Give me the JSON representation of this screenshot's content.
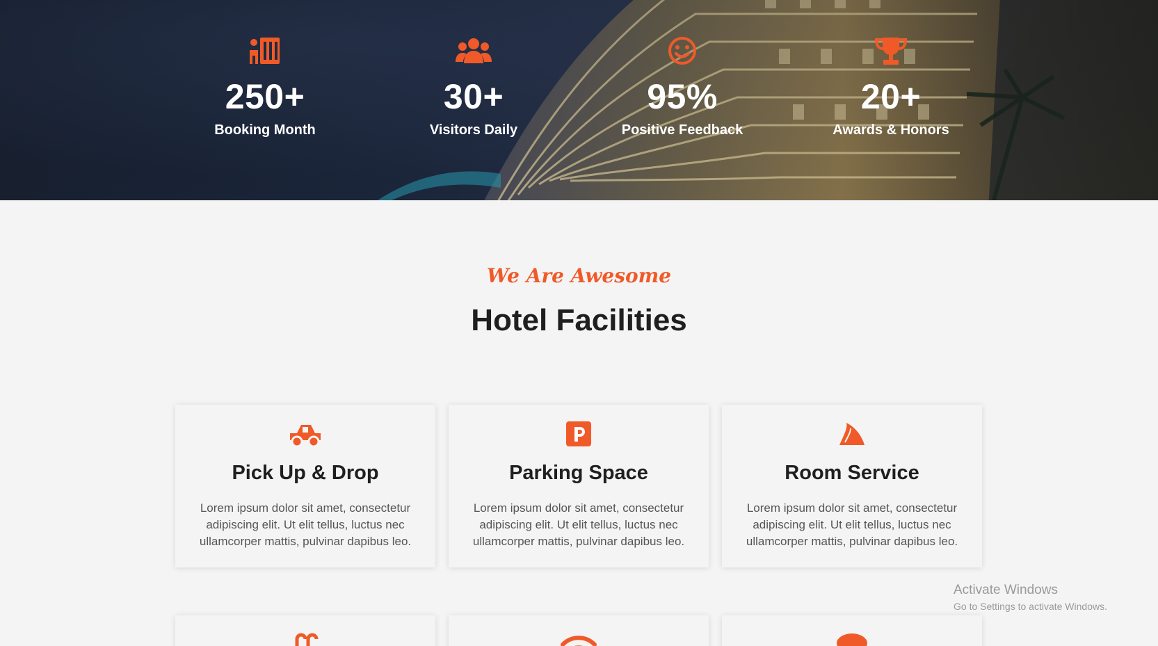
{
  "stats": [
    {
      "icon": "hotel-building-icon",
      "value": "250+",
      "label": "Booking Month"
    },
    {
      "icon": "users-group-icon",
      "value": "30+",
      "label": "Visitors Daily"
    },
    {
      "icon": "smiley-face-icon",
      "value": "95%",
      "label": "Positive Feedback"
    },
    {
      "icon": "trophy-icon",
      "value": "20+",
      "label": "Awards & Honors"
    }
  ],
  "section": {
    "tagline": "We Are Awesome",
    "title": "Hotel Facilities"
  },
  "facilities": [
    {
      "icon": "pickup-truck-icon",
      "title": "Pick Up & Drop",
      "text": "Lorem ipsum dolor sit amet, consectetur adipiscing elit. Ut elit tellus, luctus nec ullamcorper mattis, pulvinar dapibus leo."
    },
    {
      "icon": "parking-sign-icon",
      "title": "Parking Space",
      "text": "Lorem ipsum dolor sit amet, consectetur adipiscing elit. Ut elit tellus, luctus nec ullamcorper mattis, pulvinar dapibus leo."
    },
    {
      "icon": "room-service-icon",
      "title": "Room Service",
      "text": "Lorem ipsum dolor sit amet, consectetur adipiscing elit. Ut elit tellus, luctus nec ullamcorper mattis, pulvinar dapibus leo."
    },
    {
      "icon": "swimming-pool-icon"
    },
    {
      "icon": "wifi-icon"
    },
    {
      "icon": "chef-hat-icon"
    }
  ],
  "watermark": {
    "line1": "Activate Windows",
    "line2": "Go to Settings to activate Windows."
  },
  "colors": {
    "accent": "#f05a28",
    "heading": "#1f1f1f",
    "body_text": "#555555",
    "page_bg": "#f4f4f4"
  }
}
